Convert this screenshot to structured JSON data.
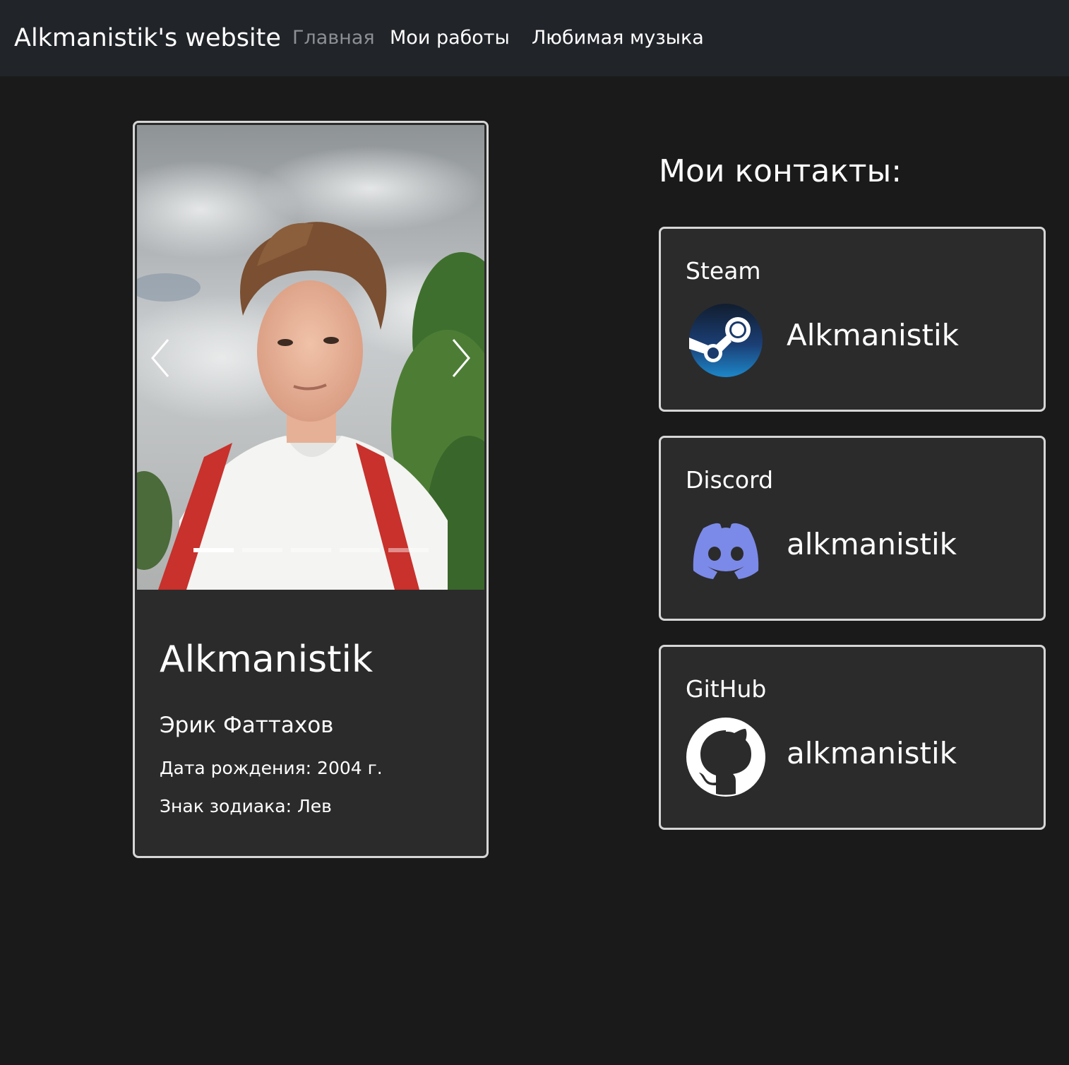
{
  "navbar": {
    "brand": "Alkmanistik's website",
    "links": [
      {
        "label": "Главная",
        "active": true
      },
      {
        "label": "Мои работы",
        "active": false
      },
      {
        "label": "Любимая музыка",
        "active": false
      }
    ]
  },
  "profile": {
    "carousel": {
      "slide_count": 5,
      "active_index": 0
    },
    "nickname": "Alkmanistik",
    "real_name": "Эрик Фаттахов",
    "birth": "Дата рождения: 2004 г.",
    "zodiac": "Знак зодиака: Лев"
  },
  "contacts": {
    "title": "Мои контакты:",
    "items": [
      {
        "service": "Steam",
        "handle": "Alkmanistik",
        "icon": "steam-icon",
        "color": "#1b5a9a"
      },
      {
        "service": "Discord",
        "handle": "alkmanistik",
        "icon": "discord-icon",
        "color": "#7289da"
      },
      {
        "service": "GitHub",
        "handle": "alkmanistik",
        "icon": "github-icon",
        "color": "#ffffff"
      }
    ]
  },
  "colors": {
    "background": "#1a1a1b",
    "navbar": "#212429",
    "card": "#2b2b2c",
    "card_border": "#d6d6d6",
    "nav_active": "#8c8f94"
  }
}
